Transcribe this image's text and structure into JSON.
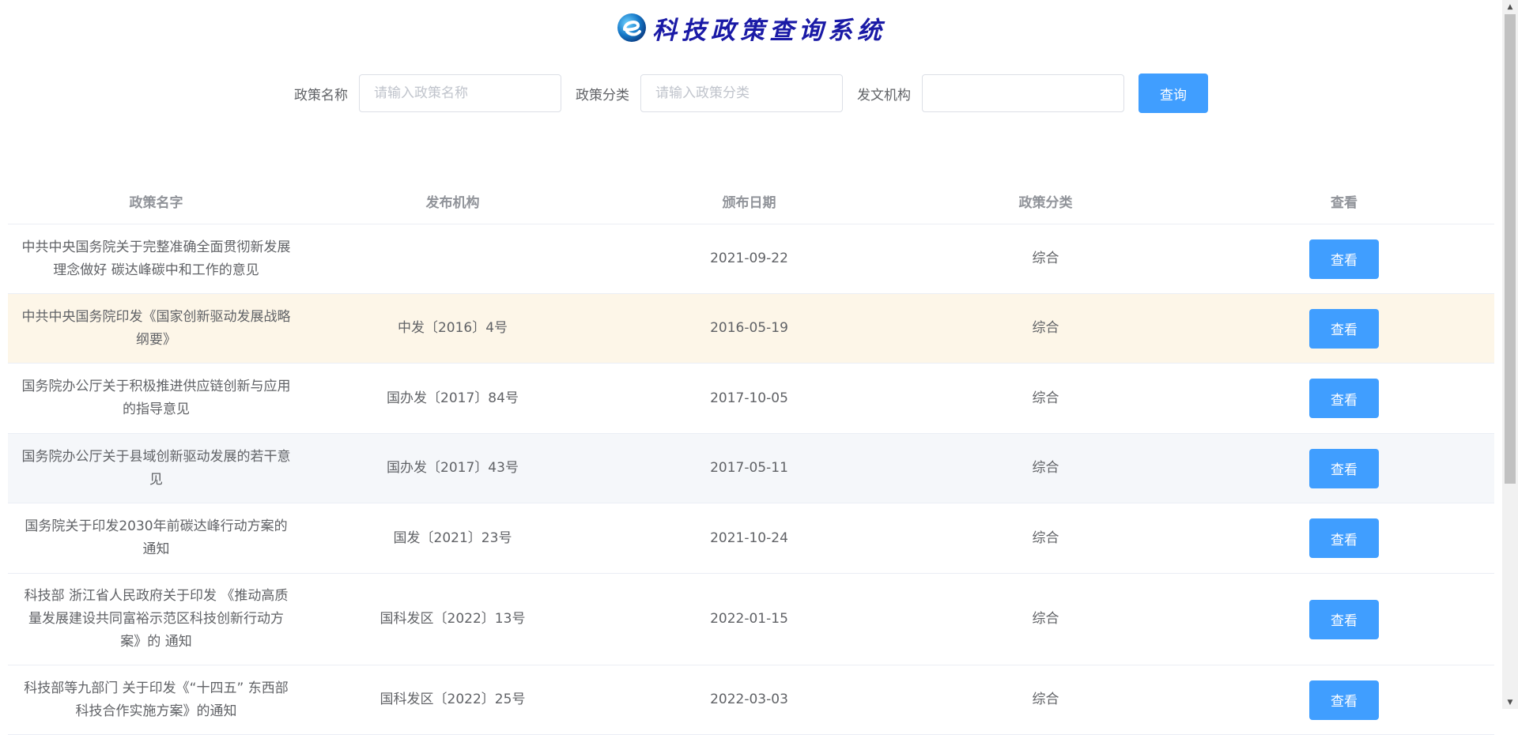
{
  "header": {
    "logo_icon": "e-globe-logo",
    "title": "科技政策查询系统"
  },
  "search": {
    "name_label": "政策名称",
    "name_placeholder": "请输入政策名称",
    "category_label": "政策分类",
    "category_placeholder": "请输入政策分类",
    "org_label": "发文机构",
    "org_placeholder": "",
    "button_label": "查询"
  },
  "table": {
    "headers": [
      "政策名字",
      "发布机构",
      "颁布日期",
      "政策分类",
      "查看"
    ],
    "rows": [
      {
        "name": "中共中央国务院关于完整准确全面贯彻新发展理念做好 碳达峰碳中和工作的意见",
        "org": "",
        "date": "2021-09-22",
        "category": "综合",
        "action": "查看"
      },
      {
        "name": "中共中央国务院印发《国家创新驱动发展战略纲要》",
        "org": "中发〔2016〕4号",
        "date": "2016-05-19",
        "category": "综合",
        "action": "查看"
      },
      {
        "name": "国务院办公厅关于积极推进供应链创新与应用的指导意见",
        "org": "国办发〔2017〕84号",
        "date": "2017-10-05",
        "category": "综合",
        "action": "查看"
      },
      {
        "name": "国务院办公厅关于县域创新驱动发展的若干意见",
        "org": "国办发〔2017〕43号",
        "date": "2017-05-11",
        "category": "综合",
        "action": "查看"
      },
      {
        "name": "国务院关于印发2030年前碳达峰行动方案的通知",
        "org": "国发〔2021〕23号",
        "date": "2021-10-24",
        "category": "综合",
        "action": "查看"
      },
      {
        "name": "科技部 浙江省人民政府关于印发 《推动高质量发展建设共同富裕示范区科技创新行动方案》的 通知",
        "org": "国科发区〔2022〕13号",
        "date": "2022-01-15",
        "category": "综合",
        "action": "查看"
      },
      {
        "name": "科技部等九部门 关于印发《“十四五” 东西部科技合作实施方案》的通知",
        "org": "国科发区〔2022〕25号",
        "date": "2022-03-03",
        "category": "综合",
        "action": "查看"
      }
    ]
  },
  "colors": {
    "primary": "#409eff",
    "logo_text": "#1a1aa6",
    "hover_row": "#fdf6e8",
    "stripe_row": "#f5f7fa"
  }
}
